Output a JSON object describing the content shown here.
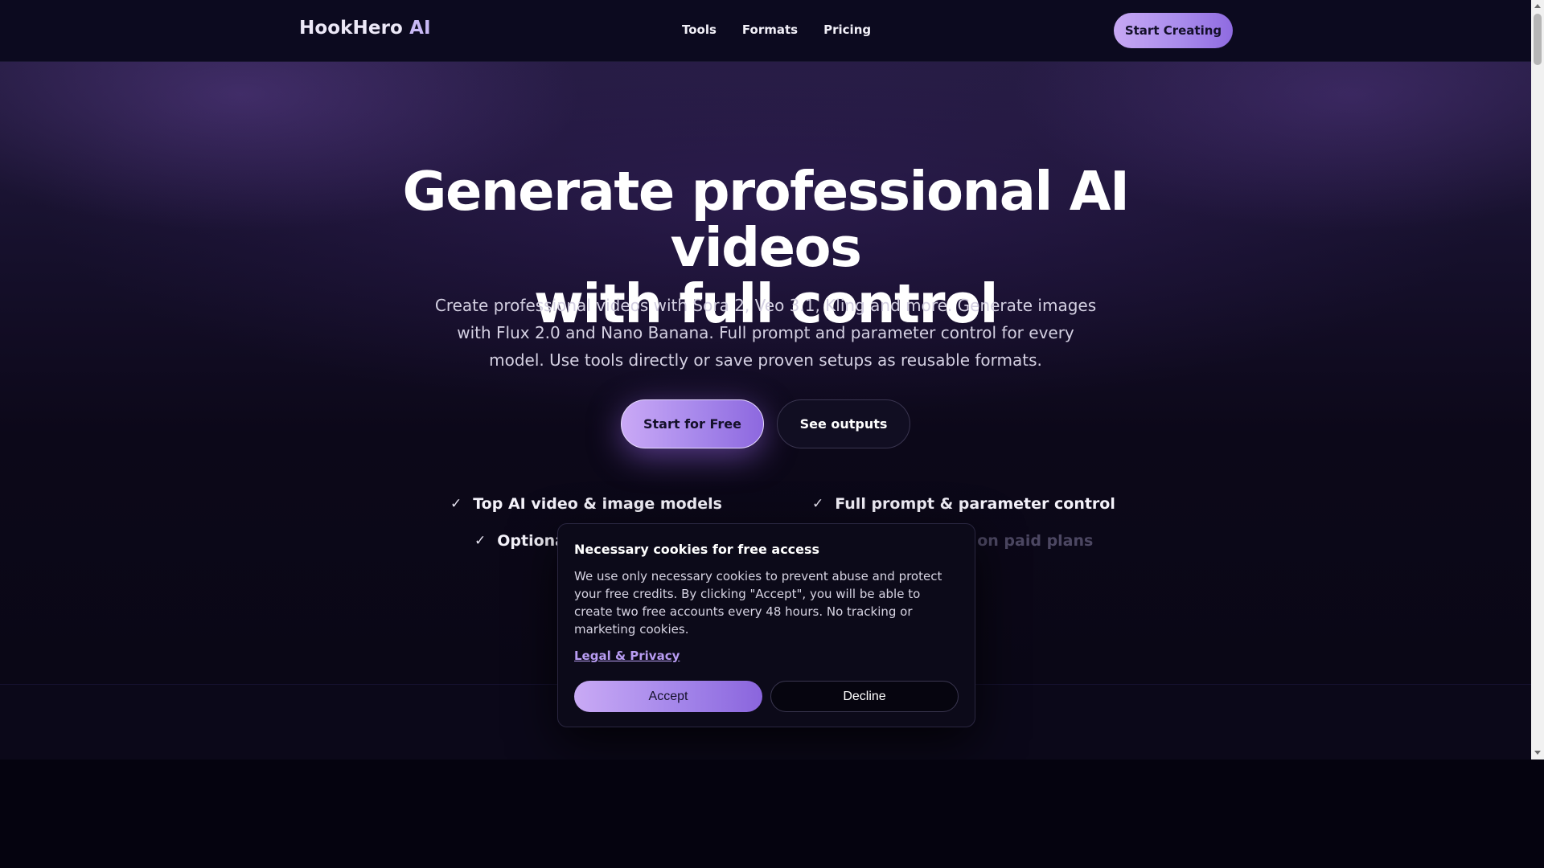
{
  "navbar": {
    "brand_name": "HookHero",
    "brand_suffix": "AI",
    "links": [
      "Tools",
      "Formats",
      "Pricing"
    ],
    "cta_label": "Start Creating"
  },
  "hero": {
    "title_line1": "Generate professional AI videos",
    "title_line2": "with full control",
    "subtitle": "Create professional videos with Sora 2, Veo 3.1, Kling and more. Generate images with Flux 2.0 and Nano Banana. Full prompt and parameter control for every model. Use tools directly or save proven setups as reusable formats.",
    "primary_button": "Start for Free",
    "secondary_button": "See outputs",
    "features": [
      "Top AI video & image models",
      "Full prompt & parameter control",
      "Optiona",
      "Watermark-free on paid plans"
    ]
  },
  "cookie_dialog": {
    "title": "Necessary cookies for free access",
    "body": "We use only necessary cookies to prevent abuse and protect your free credits. By clicking \"Accept\", you will be able to create two free accounts every 48 hours. No tracking or marketing cookies.",
    "link_label": "Legal & Privacy",
    "accept_label": "Accept",
    "decline_label": "Decline"
  },
  "icons": {
    "check": "check-icon"
  },
  "colors": {
    "accent_gradient_start": "#c9aaf5",
    "accent_gradient_end": "#8a65dd",
    "background": "#090617",
    "link": "#b89cf2"
  }
}
